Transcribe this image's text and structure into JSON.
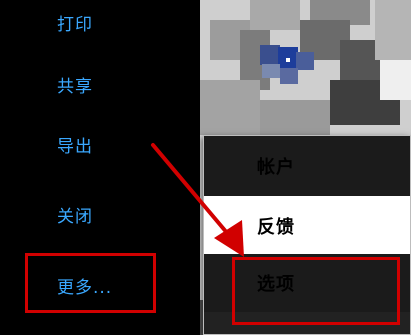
{
  "menu": {
    "items": [
      {
        "label": "打印"
      },
      {
        "label": "共享"
      },
      {
        "label": "导出"
      },
      {
        "label": "关闭"
      },
      {
        "label": "更多..."
      }
    ]
  },
  "dropdown": {
    "items": [
      {
        "label": "帐户"
      },
      {
        "label": "反馈"
      },
      {
        "label": "选项"
      }
    ]
  },
  "colors": {
    "menu_text": "#3aa8ff",
    "highlight": "#d10000",
    "background": "#000000"
  }
}
